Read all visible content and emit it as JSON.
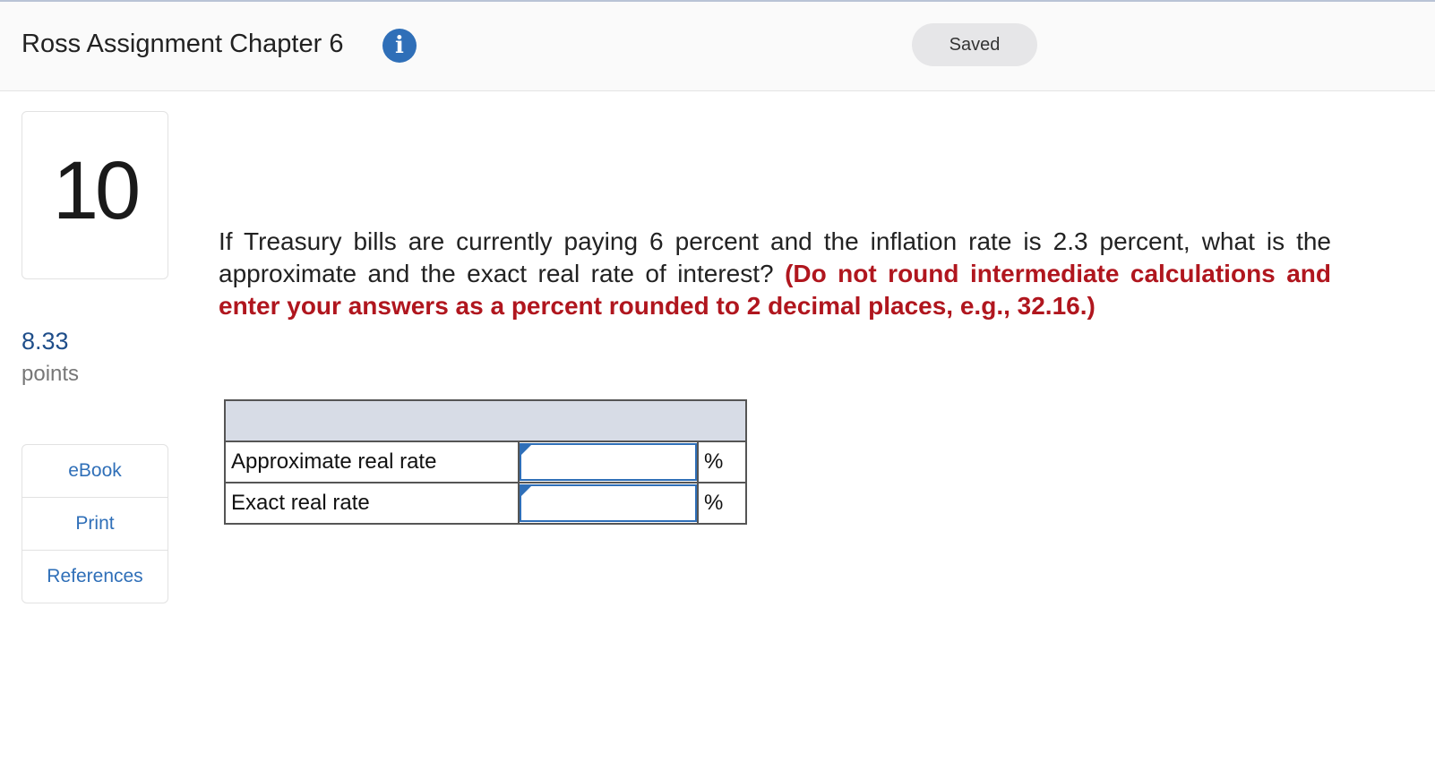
{
  "header": {
    "title": "Ross Assignment Chapter 6",
    "info_icon": "info-icon",
    "status": "Saved"
  },
  "question": {
    "number": "10",
    "points_value": "8.33",
    "points_label": "points",
    "text": "If Treasury bills are currently paying 6 percent and the inflation rate is 2.3 percent, what is the approximate and the exact real rate of interest?",
    "instruction": "(Do not round intermediate calculations and enter your answers as a percent rounded to 2 decimal places, e.g., 32.16.)"
  },
  "sidebar": {
    "links": [
      {
        "label": "eBook"
      },
      {
        "label": "Print"
      },
      {
        "label": "References"
      }
    ]
  },
  "answer_table": {
    "rows": [
      {
        "label": "Approximate real rate",
        "value": "",
        "unit": "%"
      },
      {
        "label": "Exact real rate",
        "value": "",
        "unit": "%"
      }
    ]
  },
  "colors": {
    "accent": "#2f6fb8",
    "instruction_red": "#b0161e",
    "table_header": "#d7dce6"
  }
}
